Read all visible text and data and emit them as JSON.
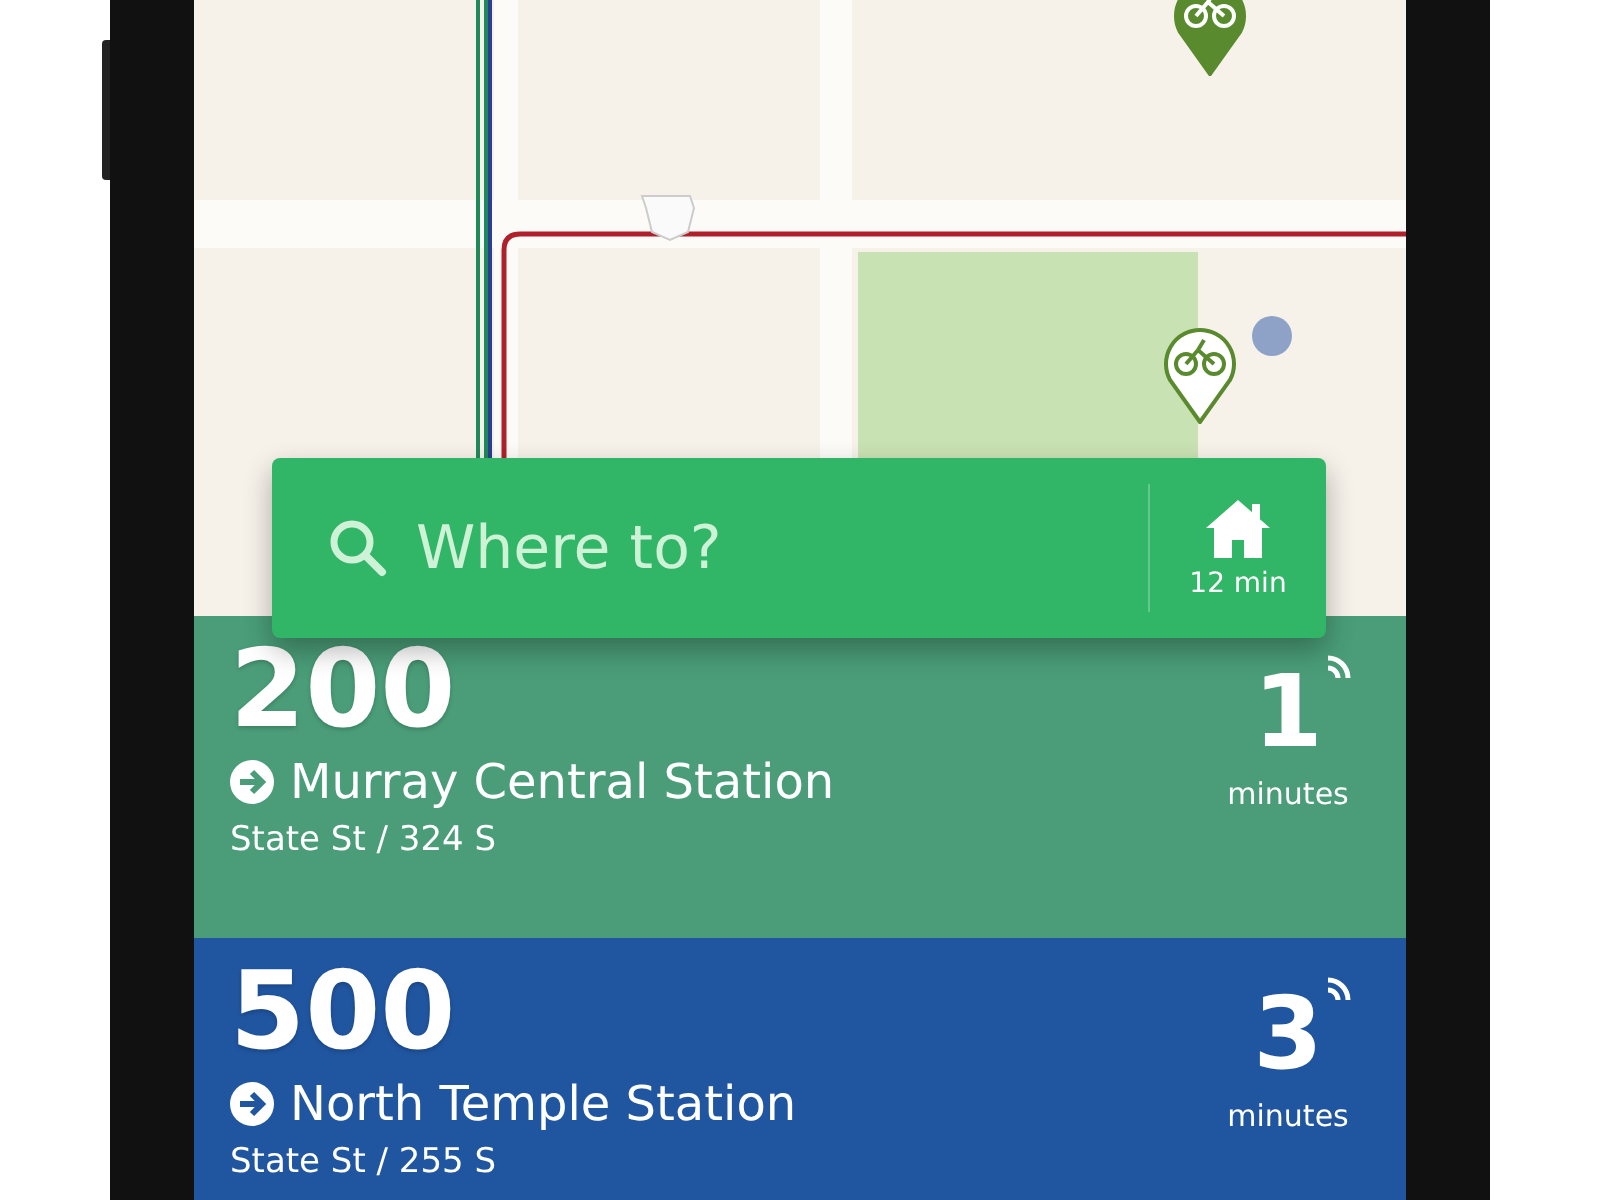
{
  "search": {
    "placeholder": "Where to?",
    "home_time": "12 min"
  },
  "departures": [
    {
      "route": "200",
      "destination": "Murray Central Station",
      "stop": "State St / 324 S",
      "minutes": "1",
      "unit": "minutes",
      "color": "#4a9d78"
    },
    {
      "route": "500",
      "destination": "North Temple Station",
      "stop": "State St / 255 S",
      "minutes": "3",
      "unit": "minutes",
      "color": "#2055a0"
    }
  ]
}
